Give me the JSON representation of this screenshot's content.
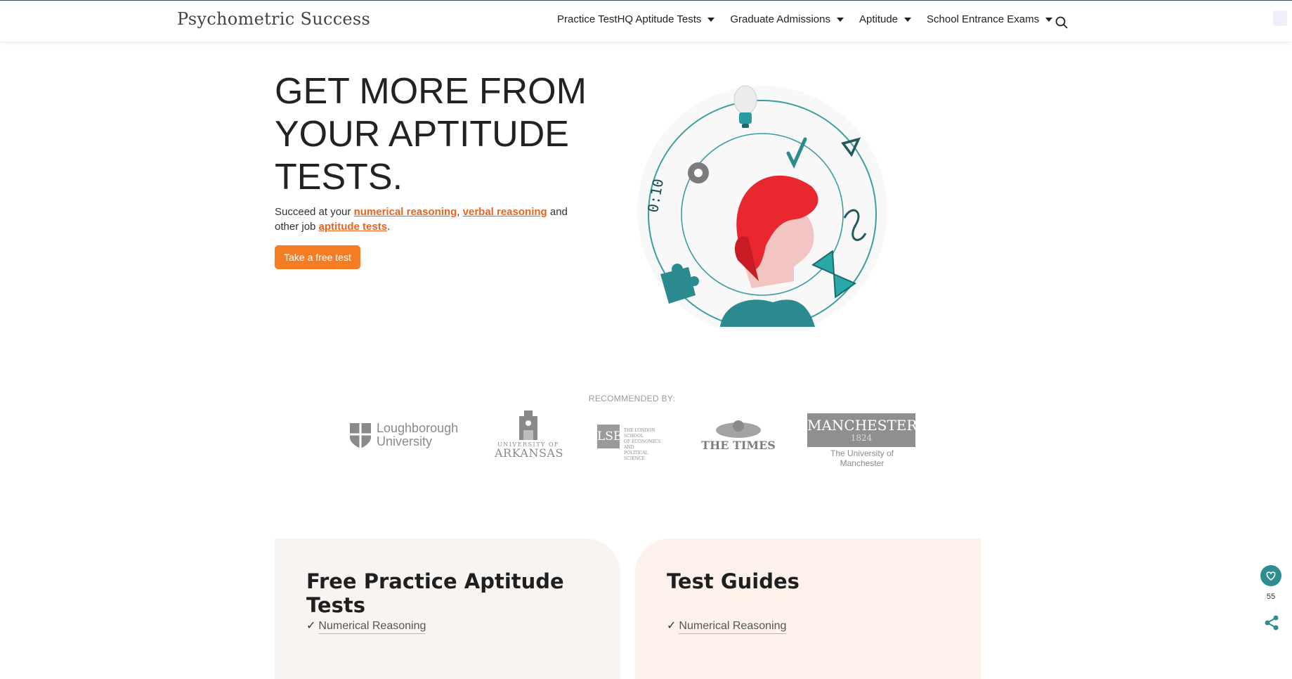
{
  "header": {
    "logo": "Psychometric Success",
    "nav": [
      "Practice TestHQ Aptitude Tests",
      "Graduate Admissions",
      "Aptitude",
      "School Entrance Exams"
    ],
    "icons": [
      "search-icon",
      "chevron-down-icon"
    ]
  },
  "hero": {
    "title": "GET MORE FROM YOUR APTITUDE TESTS.",
    "subtitle_prefix": "Succeed at your ",
    "link_numerical": "numerical reasoning",
    "sep1": ", ",
    "link_verbal": "verbal reasoning",
    "subtitle_mid": " and other job ",
    "link_aptitude": "aptitude tests",
    "subtitle_end": ".",
    "cta": "Take a free test",
    "colors": {
      "accent": "#f47c22",
      "link": "#e8641f",
      "teal": "#2e8d91",
      "red": "#e8272f"
    }
  },
  "recommended": {
    "label": "RECOMMENDED BY:",
    "partners": {
      "loughborough_1": "Loughborough",
      "loughborough_2": "University",
      "arkansas_1": "UNIVERSITY OF",
      "arkansas_2": "ARKANSAS",
      "lse": "LSE",
      "lse_small_1": "THE LONDON SCHOOL",
      "lse_small_2": "OF ECONOMICS AND",
      "lse_small_3": "POLITICAL SCIENCE",
      "times": "THE TIMES",
      "manchester": "MANCHESTER",
      "manchester_year": "1824",
      "manchester_sub": "The University of Manchester"
    }
  },
  "cards": {
    "left": {
      "title": "Free Practice Aptitude Tests",
      "check": "✓",
      "item": "Numerical Reasoning"
    },
    "right": {
      "title": "Test Guides",
      "check": "✓",
      "item": "Numerical Reasoning"
    }
  },
  "floating": {
    "fav_count": "55"
  }
}
